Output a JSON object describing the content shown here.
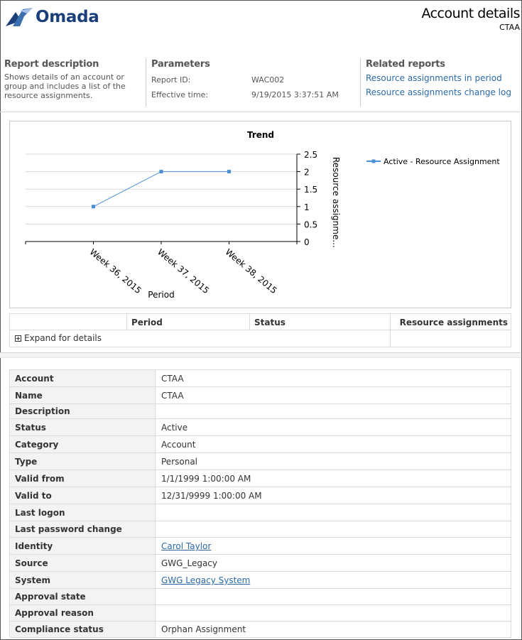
{
  "header": {
    "logo_text": "Omada",
    "title": "Account details",
    "subtitle": "CTAA"
  },
  "report_description": {
    "heading": "Report description",
    "text": "Shows details of an account or group and includes a list of the resource assignments."
  },
  "parameters": {
    "heading": "Parameters",
    "items": [
      {
        "label": "Report ID:",
        "value": "WAC002"
      },
      {
        "label": "Effective time:",
        "value": "9/19/2015 3:37:51 AM"
      }
    ]
  },
  "related_reports": {
    "heading": "Related reports",
    "links": [
      "Resource assignments in period",
      "Resource assignments change log"
    ]
  },
  "chart_data": {
    "type": "line",
    "title": "Trend",
    "xlabel": "Period",
    "ylabel": "Resource assignme...",
    "categories": [
      "Week 36, 2015",
      "Week 37, 2015",
      "Week 38, 2015"
    ],
    "series": [
      {
        "name": "Active - Resource Assignment",
        "values": [
          1,
          2,
          2
        ],
        "color": "#4a90d9"
      }
    ],
    "ylim": [
      0,
      2.5
    ],
    "yticks": [
      "2.5",
      "2",
      "1.5",
      "1",
      "0.5",
      "0"
    ],
    "grid": true,
    "legend_position": "right",
    "y_axis_side": "right"
  },
  "trend_table": {
    "columns": [
      "Period",
      "Status",
      "Resource assignments"
    ],
    "expand_label": "Expand for details"
  },
  "details": [
    {
      "label": "Account",
      "value": "CTAA"
    },
    {
      "label": "Name",
      "value": "CTAA"
    },
    {
      "label": "Description",
      "value": ""
    },
    {
      "label": "Status",
      "value": "Active"
    },
    {
      "label": "Category",
      "value": "Account"
    },
    {
      "label": "Type",
      "value": "Personal"
    },
    {
      "label": "Valid from",
      "value": "1/1/1999 1:00:00 AM"
    },
    {
      "label": "Valid to",
      "value": "12/31/9999 1:00:00 AM"
    },
    {
      "label": "Last logon",
      "value": ""
    },
    {
      "label": "Last password change",
      "value": ""
    },
    {
      "label": "Identity",
      "value": "Carol Taylor",
      "link": true
    },
    {
      "label": "Source",
      "value": "GWG_Legacy"
    },
    {
      "label": "System",
      "value": "GWG Legacy System",
      "link": true
    },
    {
      "label": "Approval state",
      "value": ""
    },
    {
      "label": "Approval reason",
      "value": ""
    },
    {
      "label": "Compliance status",
      "value": "Orphan Assignment"
    }
  ],
  "colors": {
    "link": "#2b6aa6",
    "brand": "#1a3f7a",
    "series": "#4a90d9"
  }
}
